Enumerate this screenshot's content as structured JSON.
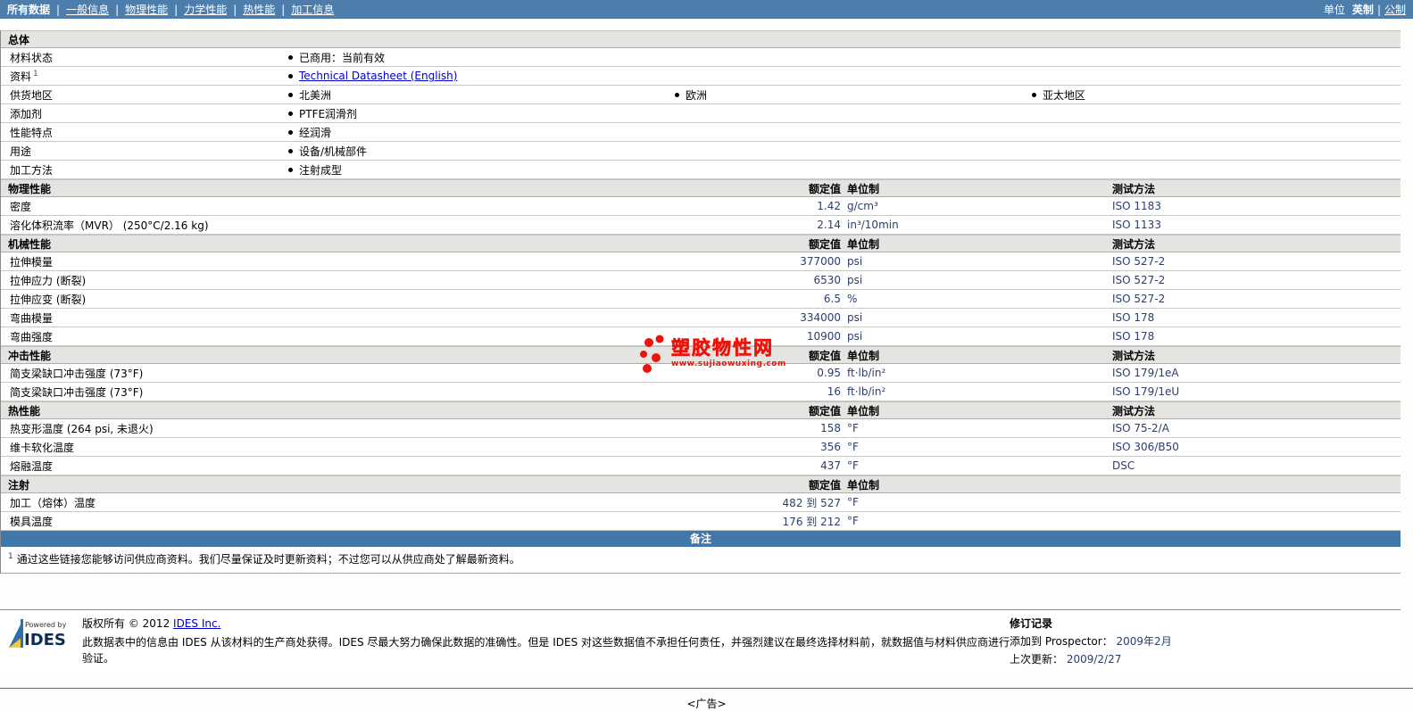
{
  "nav": {
    "items": [
      {
        "label": "所有数据",
        "active": true
      },
      {
        "label": "一般信息",
        "active": false
      },
      {
        "label": "物理性能",
        "active": false
      },
      {
        "label": "力学性能",
        "active": false
      },
      {
        "label": "热性能",
        "active": false
      },
      {
        "label": "加工信息",
        "active": false
      }
    ],
    "units_label": "单位",
    "unit_imperial": "英制",
    "unit_metric": "公制"
  },
  "table": {
    "col_headers": {
      "value": "额定值",
      "unit": "单位制",
      "test": "测试方法"
    },
    "general": {
      "title": "总体",
      "rows": [
        {
          "label": "材料状态",
          "items": [
            "已商用：当前有效"
          ]
        },
        {
          "label": "资料",
          "sup": "1",
          "link": "Technical Datasheet (English)"
        },
        {
          "label": "供货地区",
          "items": [
            "北美洲",
            "欧洲",
            "亚太地区"
          ]
        },
        {
          "label": "添加剂",
          "items": [
            "PTFE润滑剂"
          ]
        },
        {
          "label": "性能特点",
          "items": [
            "经润滑"
          ]
        },
        {
          "label": "用途",
          "items": [
            "设备/机械部件"
          ]
        },
        {
          "label": "加工方法",
          "items": [
            "注射成型"
          ]
        }
      ]
    },
    "sections": [
      {
        "title": "物理性能",
        "rows": [
          {
            "label": "密度",
            "value": "1.42",
            "unit": "g/cm³",
            "test": "ISO 1183"
          },
          {
            "label": "溶化体积流率（MVR） (250°C/2.16 kg)",
            "value": "2.14",
            "unit": "in³/10min",
            "test": "ISO 1133"
          }
        ]
      },
      {
        "title": "机械性能",
        "rows": [
          {
            "label": "拉伸模量",
            "value": "377000",
            "unit": "psi",
            "test": "ISO 527-2"
          },
          {
            "label": "拉伸应力 (断裂)",
            "value": "6530",
            "unit": "psi",
            "test": "ISO 527-2"
          },
          {
            "label": "拉伸应变 (断裂)",
            "value": "6.5",
            "unit": "%",
            "test": "ISO 527-2"
          },
          {
            "label": "弯曲模量",
            "value": "334000",
            "unit": "psi",
            "test": "ISO 178"
          },
          {
            "label": "弯曲强度",
            "value": "10900",
            "unit": "psi",
            "test": "ISO 178"
          }
        ]
      },
      {
        "title": "冲击性能",
        "rows": [
          {
            "label": "简支梁缺口冲击强度 (73°F)",
            "value": "0.95",
            "unit": "ft·lb/in²",
            "test": "ISO 179/1eA"
          },
          {
            "label": "简支梁缺口冲击强度 (73°F)",
            "value": "16",
            "unit": "ft·lb/in²",
            "test": "ISO 179/1eU"
          }
        ]
      },
      {
        "title": "热性能",
        "rows": [
          {
            "label": "热变形温度  (264 psi, 未退火)",
            "value": "158",
            "unit": "°F",
            "test": "ISO 75-2/A"
          },
          {
            "label": "维卡软化温度",
            "value": "356",
            "unit": "°F",
            "test": "ISO 306/B50"
          },
          {
            "label": "熔融温度",
            "value": "437",
            "unit": "°F",
            "test": "DSC"
          }
        ]
      },
      {
        "title": "注射",
        "rows": [
          {
            "label": "加工（熔体）温度",
            "value": "482 到 527",
            "unit": "°F",
            "test": ""
          },
          {
            "label": "模具温度",
            "value": "176 到 212",
            "unit": "°F",
            "test": ""
          }
        ]
      }
    ],
    "remark_header": "备注",
    "footnote_sup": "1",
    "footnote": "通过这些链接您能够访问供应商资料。我们尽量保证及时更新资料；不过您可以从供应商处了解最新资料。"
  },
  "watermark": {
    "title": "塑胶物性网",
    "url": "www.sujiaowuxing.com"
  },
  "footer": {
    "powered_by": "Powered by",
    "logo_name": "IDES",
    "copyright_label": "版权所有",
    "copyright_year": "© 2012",
    "copyright_company": "IDES Inc.",
    "disclaimer": "此数据表中的信息由 IDES 从该材料的生产商处获得。IDES 尽最大努力确保此数据的准确性。但是 IDES 对这些数据值不承担任何责任，并强烈建议在最终选择材料前，就数据值与材料供应商进行验证。",
    "revision": {
      "title": "修订记录",
      "added_label": "添加到  Prospector：",
      "added_value": "2009年2月",
      "updated_label": "上次更新：",
      "updated_value": "2009/2/27"
    }
  },
  "ad_label": "<广告>"
}
